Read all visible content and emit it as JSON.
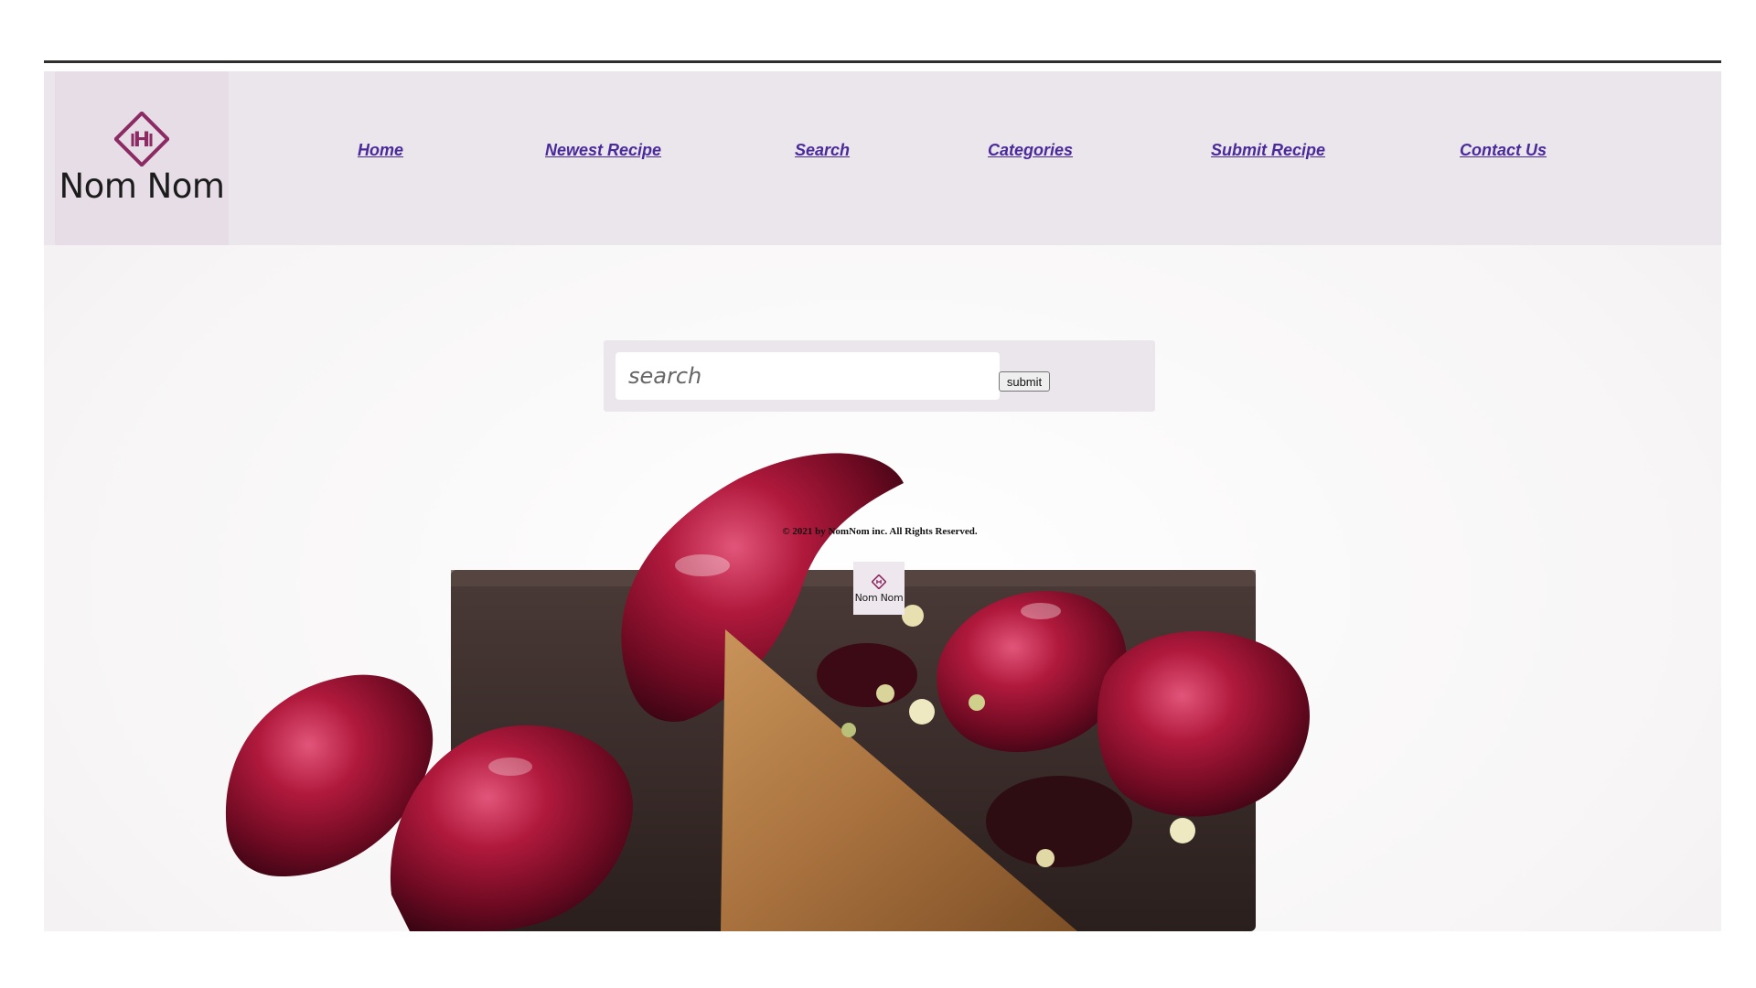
{
  "brand": {
    "name": "Nom Nom",
    "logo_icon": "hh-diamond-icon",
    "accent": "#8b2a63",
    "header_bg": "#ebe6ec"
  },
  "nav": {
    "items": [
      {
        "label": "Home"
      },
      {
        "label": "Newest Recipe"
      },
      {
        "label": "Search"
      },
      {
        "label": "Categories"
      },
      {
        "label": "Submit Recipe"
      },
      {
        "label": "Contact Us"
      }
    ],
    "link_color": "#4a2a9a"
  },
  "search": {
    "placeholder": "search",
    "value": "",
    "submit_label": "submit"
  },
  "footer": {
    "copyright": "© 2021 by NomNom inc. All Rights Reserved.",
    "logo_text": "Nom Nom"
  },
  "hero": {
    "image": "dessert-cherries-chocolate-brittle"
  }
}
